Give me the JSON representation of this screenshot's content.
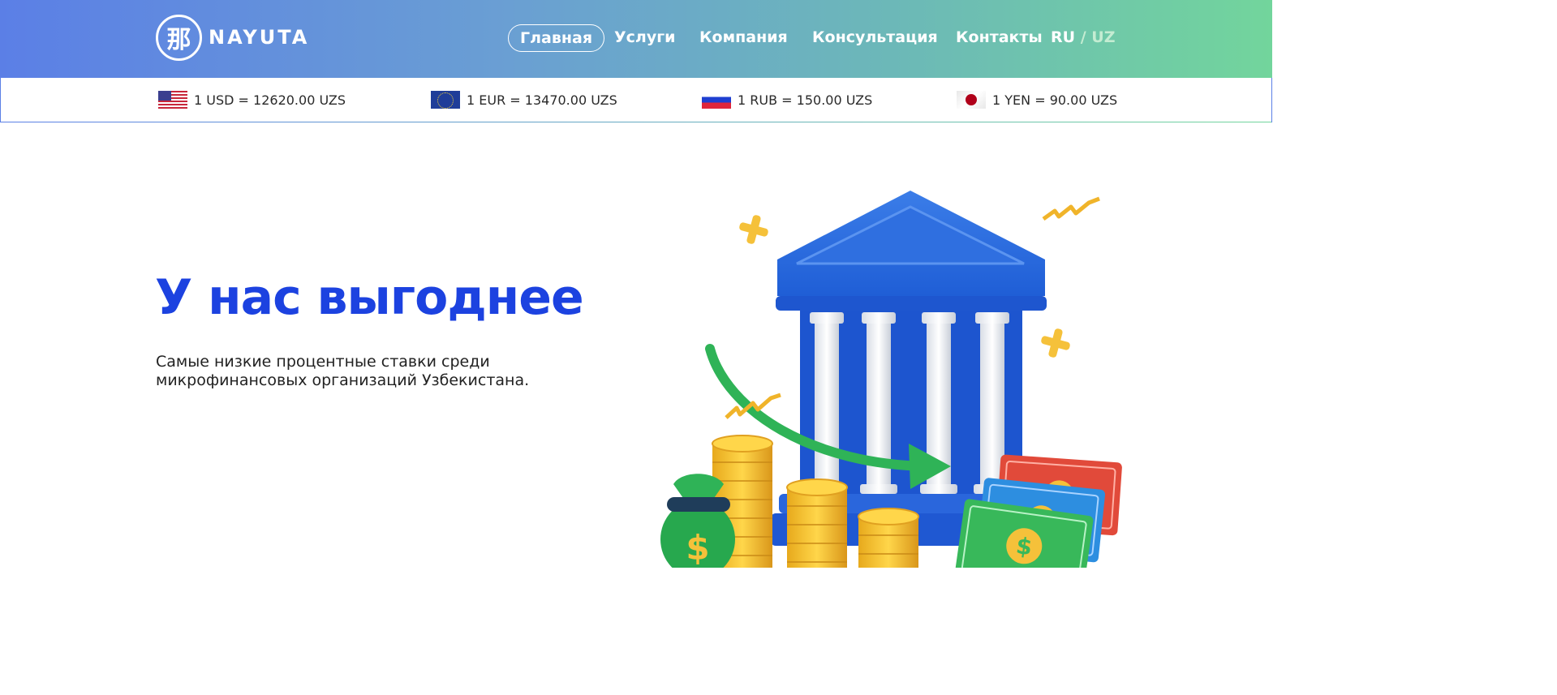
{
  "brand": {
    "logo_glyph": "那",
    "name": "NAYUTA"
  },
  "nav": {
    "items": [
      {
        "label": "Главная",
        "active": true
      },
      {
        "label": "Услуги",
        "active": false
      },
      {
        "label": "Компания",
        "active": false
      },
      {
        "label": "Консультация",
        "active": false
      },
      {
        "label": "Контакты",
        "active": false
      }
    ],
    "lang": {
      "current": "RU",
      "separator": "/",
      "other": "UZ"
    }
  },
  "rates": [
    {
      "flag": "us-flag-icon",
      "text": "1 USD = 12620.00 UZS"
    },
    {
      "flag": "eu-flag-icon",
      "text": "1 EUR = 13470.00 UZS"
    },
    {
      "flag": "ru-flag-icon",
      "text": "1 RUB = 150.00 UZS"
    },
    {
      "flag": "jp-flag-icon",
      "text": "1 YEN = 90.00 UZS"
    }
  ],
  "hero": {
    "title": "У нас выгоднее",
    "subtitle": "Самые низкие процентные ставки среди микрофинансовых организаций Узбекистана."
  },
  "colors": {
    "accent": "#1c42e0",
    "header_start": "#5b7fe6",
    "header_end": "#72d59c"
  }
}
